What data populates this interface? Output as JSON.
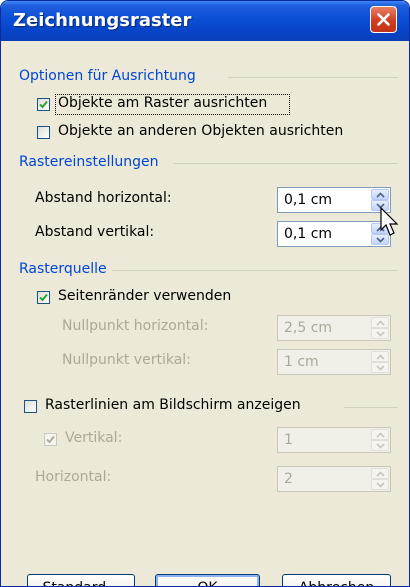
{
  "dialog": {
    "title": "Zeichnungsraster",
    "close_icon": "close-icon",
    "accent_color": "#0a4fd6",
    "section_color": "#0046d5"
  },
  "alignment": {
    "header": "Optionen für Ausrichtung",
    "snap_to_grid": {
      "label": "Objekte am Raster ausrichten",
      "checked": true
    },
    "snap_to_objects": {
      "label": "Objekte an anderen Objekten ausrichten",
      "checked": false
    }
  },
  "grid_settings": {
    "header": "Rastereinstellungen",
    "horizontal_spacing": {
      "label": "Abstand horizontal:",
      "value": "0,1 cm"
    },
    "vertical_spacing": {
      "label": "Abstand vertikal:",
      "value": "0,1 cm"
    }
  },
  "grid_origin": {
    "header": "Rasterquelle",
    "use_margins": {
      "label": "Seitenränder verwenden",
      "checked": true
    },
    "horizontal_origin": {
      "label": "Nullpunkt horizontal:",
      "value": "2,5 cm"
    },
    "vertical_origin": {
      "label": "Nullpunkt vertikal:",
      "value": "1 cm"
    }
  },
  "gridlines": {
    "show_on_screen": {
      "label": "Rasterlinien am Bildschirm anzeigen",
      "checked": false
    },
    "vertical": {
      "label": "Vertikal:",
      "checked": true,
      "value": "1"
    },
    "horizontal": {
      "label": "Horizontal:",
      "value": "2"
    }
  },
  "buttons": {
    "default_label": "Standard...",
    "ok_label": "OK",
    "cancel_label": "Abbrechen"
  }
}
